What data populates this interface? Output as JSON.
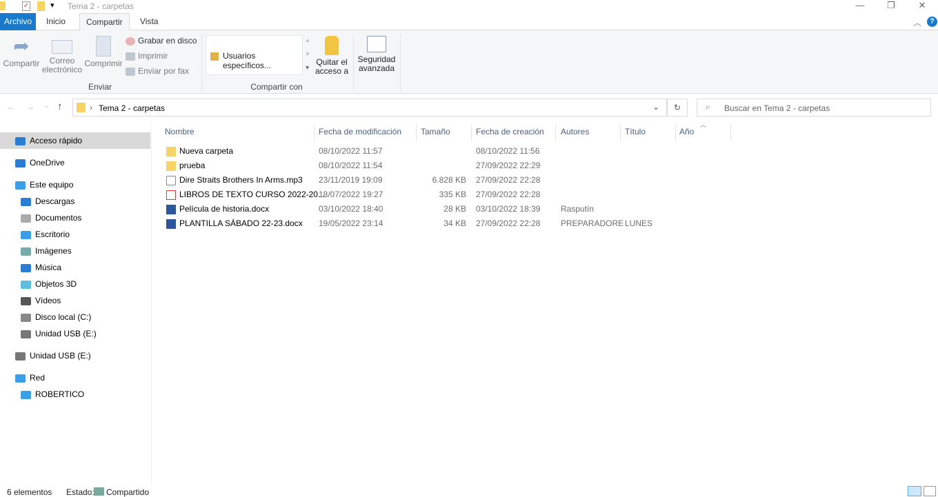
{
  "window": {
    "title": "Tema 2 - carpetas",
    "controls": [
      "minimize",
      "maximize",
      "close"
    ]
  },
  "tabs": [
    {
      "label": "Archivo"
    },
    {
      "label": "Inicio"
    },
    {
      "label": "Compartir"
    },
    {
      "label": "Vista"
    }
  ],
  "ribbon": {
    "enviar": {
      "label": "Enviar",
      "share": "Compartir",
      "email": "Correo electrónico",
      "zip": "Comprimir",
      "burn": "Grabar en disco",
      "print": "Imprimir",
      "fax": "Enviar por fax"
    },
    "compartir_con": {
      "label": "Compartir con",
      "gallery_item": "Usuarios específicos...",
      "remove_access_1": "Quitar el",
      "remove_access_2": "acceso a"
    },
    "security_1": "Seguridad",
    "security_2": "avanzada"
  },
  "address": {
    "path": "Tema 2 - carpetas",
    "search_placeholder": "Buscar en Tema 2 - carpetas"
  },
  "sidebar": [
    {
      "label": "Acceso rápido",
      "level": 0,
      "selected": true,
      "icon": "star-icon",
      "color": "#2b7cd3"
    },
    {
      "label": "OneDrive",
      "level": 0,
      "icon": "cloud-icon",
      "color": "#2b7cd3"
    },
    {
      "label": "Este equipo",
      "level": 0,
      "icon": "computer-icon",
      "color": "#3b9ee8"
    },
    {
      "label": "Descargas",
      "level": 1,
      "icon": "download-icon",
      "color": "#2b7cd3"
    },
    {
      "label": "Documentos",
      "level": 1,
      "icon": "documents-icon",
      "color": "#aaa"
    },
    {
      "label": "Escritorio",
      "level": 1,
      "icon": "desktop-icon",
      "color": "#3b9ee8"
    },
    {
      "label": "Imágenes",
      "level": 1,
      "icon": "pictures-icon",
      "color": "#7aa"
    },
    {
      "label": "Música",
      "level": 1,
      "icon": "music-icon",
      "color": "#2b7cd3"
    },
    {
      "label": "Objetos 3D",
      "level": 1,
      "icon": "cube-icon",
      "color": "#5bc0de"
    },
    {
      "label": "Vídeos",
      "level": 1,
      "icon": "video-icon",
      "color": "#555"
    },
    {
      "label": "Disco local (C:)",
      "level": 1,
      "icon": "drive-icon",
      "color": "#888"
    },
    {
      "label": "Unidad USB (E:)",
      "level": 1,
      "icon": "usb-drive-icon",
      "color": "#777"
    },
    {
      "label": "Unidad USB (E:)",
      "level": 0,
      "icon": "usb-drive-icon",
      "color": "#777"
    },
    {
      "label": "Red",
      "level": 0,
      "icon": "network-icon",
      "color": "#3b9ee8"
    },
    {
      "label": "ROBERTICO",
      "level": 1,
      "icon": "computer-icon",
      "color": "#3b9ee8"
    }
  ],
  "columns": [
    "Nombre",
    "Fecha de modificación",
    "Tamaño",
    "Fecha de creación",
    "Autores",
    "Título",
    "Año"
  ],
  "files": [
    {
      "name": "Nueva carpeta",
      "modified": "08/10/2022 11:57",
      "size": "",
      "created": "08/10/2022 11:56",
      "authors": "",
      "title": "",
      "type": "folder"
    },
    {
      "name": "prueba",
      "modified": "08/10/2022 11:54",
      "size": "",
      "created": "27/09/2022 22:29",
      "authors": "",
      "title": "",
      "type": "folder"
    },
    {
      "name": "Dire Straits   Brothers In Arms.mp3",
      "modified": "23/11/2019 19:09",
      "size": "6.828 KB",
      "created": "27/09/2022 22:28",
      "authors": "",
      "title": "",
      "type": "audio"
    },
    {
      "name": "LIBROS DE TEXTO CURSO 2022-20...",
      "modified": "18/07/2022 19:27",
      "size": "335 KB",
      "created": "27/09/2022 22:28",
      "authors": "",
      "title": "",
      "type": "pdf"
    },
    {
      "name": "Película de historia.docx",
      "modified": "03/10/2022 18:40",
      "size": "28 KB",
      "created": "03/10/2022 18:39",
      "authors": "Rasputín",
      "title": "",
      "type": "word"
    },
    {
      "name": "PLANTILLA SÁBADO 22-23.docx",
      "modified": "19/05/2022 23:14",
      "size": "34 KB",
      "created": "27/09/2022 22:28",
      "authors": "PREPARADORE",
      "title": "LUNES",
      "type": "word"
    }
  ],
  "status": {
    "count": "6 elementos",
    "state_label": "Estado:",
    "state_value": "Compartido"
  },
  "colors": {
    "accent": "#1979ca",
    "selected": "#cce8ff"
  }
}
